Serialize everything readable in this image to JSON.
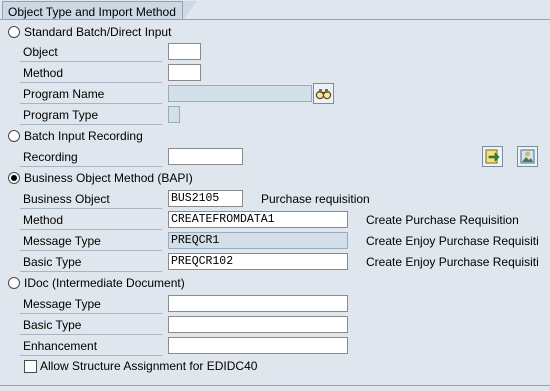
{
  "tab": {
    "title": "Object Type and Import Method"
  },
  "standard": {
    "radio_label": "Standard Batch/Direct Input",
    "object_label": "Object",
    "object_value": "",
    "method_label": "Method",
    "method_value": "",
    "program_name_label": "Program Name",
    "program_name_value": "",
    "program_type_label": "Program Type",
    "program_type_value": ""
  },
  "recording": {
    "radio_label": "Batch Input Recording",
    "recording_label": "Recording",
    "recording_value": ""
  },
  "bapi": {
    "radio_label": "Business Object Method  (BAPI)",
    "business_object_label": "Business Object",
    "business_object_value": "BUS2105",
    "business_object_desc": "Purchase requisition",
    "method_label": "Method",
    "method_value": "CREATEFROMDATA1",
    "method_desc": "Create Purchase Requisition",
    "message_type_label": "Message Type",
    "message_type_value": "PREQCR1",
    "message_type_desc": "Create Enjoy Purchase Requisiti",
    "basic_type_label": "Basic Type",
    "basic_type_value": "PREQCR102",
    "basic_type_desc": "Create Enjoy Purchase Requisiti"
  },
  "idoc": {
    "radio_label": "IDoc (Intermediate Document)",
    "message_type_label": "Message Type",
    "message_type_value": "",
    "basic_type_label": "Basic Type",
    "basic_type_value": "",
    "enhancement_label": "Enhancement",
    "enhancement_value": ""
  },
  "checkbox": {
    "label": "Allow Structure Assignment for EDIDC40",
    "checked": false
  },
  "selected_method": "bapi",
  "icons": {
    "program_search": "search-binoculars-icon",
    "execute": "execute-arrow-icon",
    "display": "display-picture-icon"
  }
}
